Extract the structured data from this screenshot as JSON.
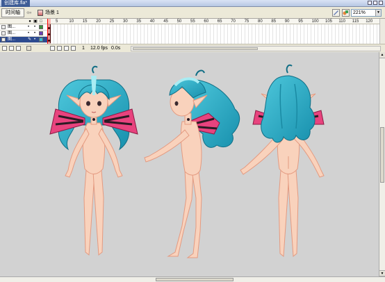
{
  "document": {
    "title": "创建库.fla*"
  },
  "editbar": {
    "timeline_label": "时间轴",
    "scene_label": "场景 1",
    "zoom": "221%"
  },
  "timeline": {
    "layers": [
      {
        "name": "图..."
      },
      {
        "name": "图..."
      },
      {
        "name": "图..."
      }
    ],
    "ruler": [
      "5",
      "10",
      "15",
      "20",
      "25",
      "30",
      "35",
      "40",
      "45",
      "50",
      "55",
      "60",
      "65",
      "70",
      "75",
      "80",
      "85",
      "90",
      "95",
      "100",
      "105",
      "110",
      "115",
      "120"
    ],
    "current_frame": "1",
    "fps": "12.0 fps",
    "time": "0.0s"
  },
  "colors": {
    "hair": "#2bb0c8",
    "hair_highlight": "#a8ecf3",
    "skin": "#f9d2bc",
    "skin_outline": "#e49a80",
    "wing_pink": "#e8437e",
    "wing_dark": "#2b1b24",
    "stage_bg": "#d2d2d2"
  }
}
